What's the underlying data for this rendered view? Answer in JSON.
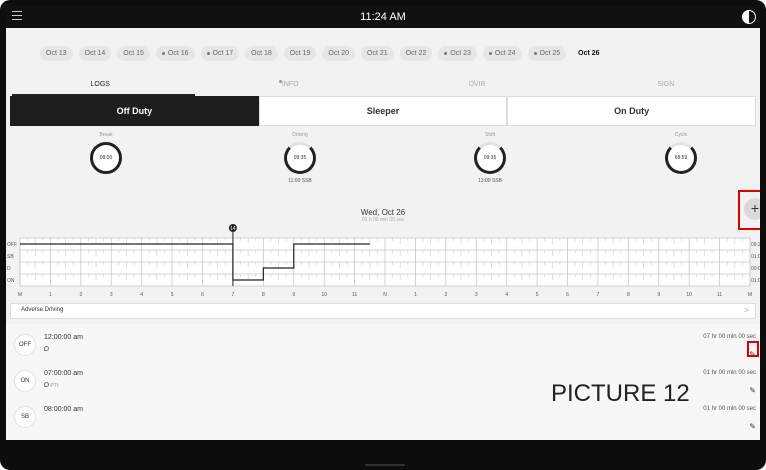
{
  "status_bar": {
    "time": "11:24 AM",
    "menu_icon": "menu-icon",
    "theme_icon": "contrast-icon"
  },
  "dates": [
    {
      "label": "Oct 13",
      "dot": false,
      "active": false
    },
    {
      "label": "Oct 14",
      "dot": false,
      "active": false
    },
    {
      "label": "Oct 15",
      "dot": false,
      "active": false
    },
    {
      "label": "Oct 16",
      "dot": true,
      "active": false
    },
    {
      "label": "Oct 17",
      "dot": true,
      "active": false
    },
    {
      "label": "Oct 18",
      "dot": false,
      "active": false
    },
    {
      "label": "Oct 19",
      "dot": false,
      "active": false
    },
    {
      "label": "Oct 20",
      "dot": false,
      "active": false
    },
    {
      "label": "Oct 21",
      "dot": false,
      "active": false
    },
    {
      "label": "Oct 22",
      "dot": false,
      "active": false
    },
    {
      "label": "Oct 23",
      "dot": true,
      "active": false
    },
    {
      "label": "Oct 24",
      "dot": true,
      "active": false
    },
    {
      "label": "Oct 25",
      "dot": true,
      "active": false
    },
    {
      "label": "Oct 26",
      "dot": false,
      "active": true
    }
  ],
  "tabs": [
    {
      "label": "LOGS",
      "active": true,
      "dot": false
    },
    {
      "label": "INFO",
      "active": false,
      "dot": true
    },
    {
      "label": "DVIR",
      "active": false,
      "dot": false
    },
    {
      "label": "SIGN",
      "active": false,
      "dot": false
    }
  ],
  "duty_buttons": [
    {
      "label": "Off Duty",
      "active": true
    },
    {
      "label": "Sleeper",
      "active": false
    },
    {
      "label": "On Duty",
      "active": false
    }
  ],
  "clocks": [
    {
      "label": "Break",
      "value": "08:00",
      "sub": "",
      "full": true
    },
    {
      "label": "Driving",
      "value": "09:35",
      "sub": "11:00 SSB",
      "full": false
    },
    {
      "label": "Shift",
      "value": "09:35",
      "sub": "13:00 SSB",
      "full": false
    },
    {
      "label": "Cycle",
      "value": "68:59",
      "sub": "",
      "full": false
    }
  ],
  "graph": {
    "date": "Wed, Oct 26",
    "subtitle": "01 h 00 min 00 sec",
    "marker": "14",
    "row_labels": [
      "OFF",
      "SB",
      "D",
      "ON"
    ],
    "totals": [
      "09:2",
      "01:0",
      "00:0",
      "01:0"
    ],
    "hour_labels": [
      "M",
      "1",
      "2",
      "3",
      "4",
      "5",
      "6",
      "7",
      "8",
      "9",
      "10",
      "11",
      "N",
      "1",
      "2",
      "3",
      "4",
      "5",
      "6",
      "7",
      "8",
      "9",
      "10",
      "11",
      "M"
    ],
    "add_icon": "+",
    "colors": {
      "line": "#222222",
      "grid": "#c8c8c8"
    }
  },
  "adverse": {
    "label": "Adverse Driving",
    "chevron": ">"
  },
  "entries": [
    {
      "status": "OFF",
      "time": "12:00:00 am",
      "note": "",
      "duration": "07 hr 00 min 00 sec"
    },
    {
      "status": "ON",
      "time": "07:00:00 am",
      "note": "PTI;",
      "duration": "01 hr 00 min 00 sec"
    },
    {
      "status": "SB",
      "time": "08:00:00 am",
      "note": "",
      "duration": "01 hr 00 min 00 sec"
    }
  ],
  "edit_icon": "✎",
  "picture_label": "PICTURE 12",
  "highlight_color": "#e00000"
}
